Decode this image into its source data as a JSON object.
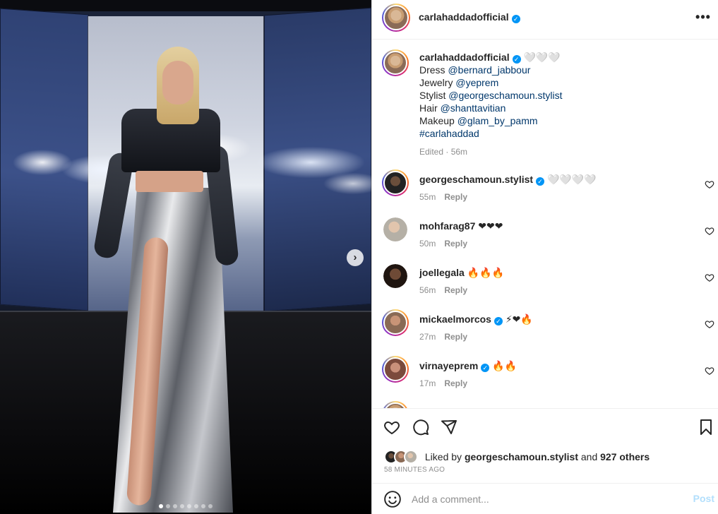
{
  "post": {
    "author": "carlahaddadofficial",
    "verified": true
  },
  "caption": {
    "author": "carlahaddadofficial",
    "emojis": "🤍🤍🤍",
    "lines": [
      {
        "label": "Dress",
        "mention": "@bernard_jabbour"
      },
      {
        "label": "Jewelry",
        "mention": "@yeprem"
      },
      {
        "label": "Stylist",
        "mention": "@georgeschamoun.stylist"
      },
      {
        "label": "Hair",
        "mention": "@shanttavitian"
      },
      {
        "label": "Makeup",
        "mention": "@glam_by_pamm"
      }
    ],
    "hashtag": "#carlahaddad",
    "meta": "Edited · 56m"
  },
  "comments": [
    {
      "user": "georgeschamoun.stylist",
      "verified": true,
      "text": "🤍🤍🤍🤍",
      "time": "55m",
      "reply": "Reply"
    },
    {
      "user": "mohfarag87",
      "verified": false,
      "text": "❤❤❤",
      "time": "50m",
      "reply": "Reply"
    },
    {
      "user": "joellegala",
      "verified": false,
      "text": "🔥🔥🔥",
      "time": "56m",
      "reply": "Reply"
    },
    {
      "user": "mickaelmorcos",
      "verified": true,
      "text": "⚡❤🔥",
      "time": "27m",
      "reply": "Reply"
    },
    {
      "user": "virnayeprem",
      "verified": true,
      "text": "🔥🔥",
      "time": "17m",
      "reply": "Reply"
    }
  ],
  "likes": {
    "prefix": "Liked by",
    "user": "georgeschamoun.stylist",
    "connector": "and",
    "others": "927 others"
  },
  "posted_ago": "58 MINUTES AGO",
  "comment_box": {
    "placeholder": "Add a comment...",
    "post_label": "Post"
  },
  "carousel": {
    "next_glyph": "›",
    "slide_count": 8,
    "active_slide": 1
  },
  "icons": {
    "more": "more-options-icon",
    "like": "heart-icon",
    "comment": "comment-icon",
    "share": "share-icon",
    "save": "bookmark-icon",
    "emoji": "emoji-icon",
    "verified": "verified-badge-icon"
  },
  "colors": {
    "link": "#00376b",
    "verified": "#0095f6",
    "muted": "#8e8e8e",
    "post_disabled": "#b2dffc"
  }
}
